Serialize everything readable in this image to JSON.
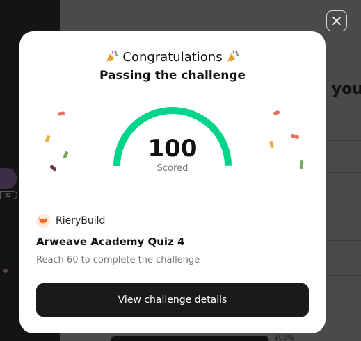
{
  "background": {
    "heading_partial": "o you",
    "avatar_badge": "32",
    "progress_label": "100%"
  },
  "modal": {
    "title": "Congratulations",
    "title_icon": "party-popper-icon",
    "subtitle": "Passing the challenge",
    "score": "100",
    "score_label": "Scored",
    "score_fraction": 1.0,
    "gauge_color": "#00d68a",
    "brand": {
      "icon": "fox-logo-icon",
      "name": "RieryBuild"
    },
    "quiz_title": "Arweave Academy Quiz 4",
    "requirement": "Reach 60 to complete the challenge",
    "view_button_label": "View challenge details"
  },
  "close_icon": "close-icon"
}
